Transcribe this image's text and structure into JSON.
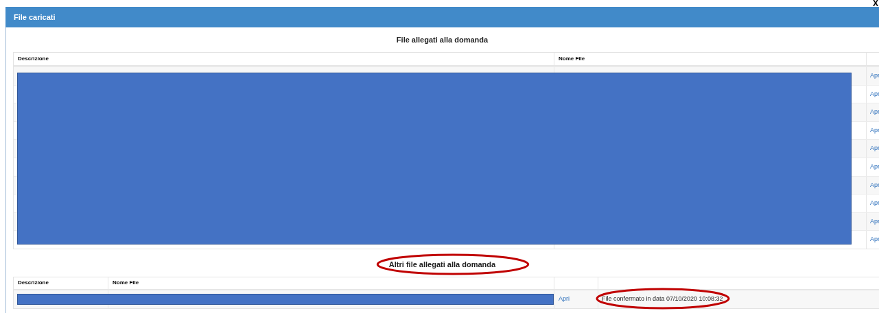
{
  "dialog": {
    "title": "File caricati",
    "close": "X"
  },
  "main_section": {
    "title": "File allegati alla domanda",
    "redacted": true,
    "columns": [
      "Descrizione",
      "Nome File"
    ],
    "rows": [
      {
        "action": "Apr"
      },
      {
        "action": "Apr"
      },
      {
        "action": "Apr"
      },
      {
        "action": "Apr"
      },
      {
        "action": "Apr"
      },
      {
        "action": "Apr"
      },
      {
        "action": "Apr"
      },
      {
        "action": "Apr"
      },
      {
        "action": "Apr"
      },
      {
        "action": "Apr"
      }
    ]
  },
  "other_section": {
    "title": "Altri file allegati alla domanda",
    "title_circled": true,
    "redacted": true,
    "columns": [
      "Descrizione",
      "Nome File"
    ],
    "rows": [
      {
        "action": "Apri",
        "status": "File confermato in data 07/10/2020 10:08:32",
        "status_circled": true
      }
    ]
  }
}
